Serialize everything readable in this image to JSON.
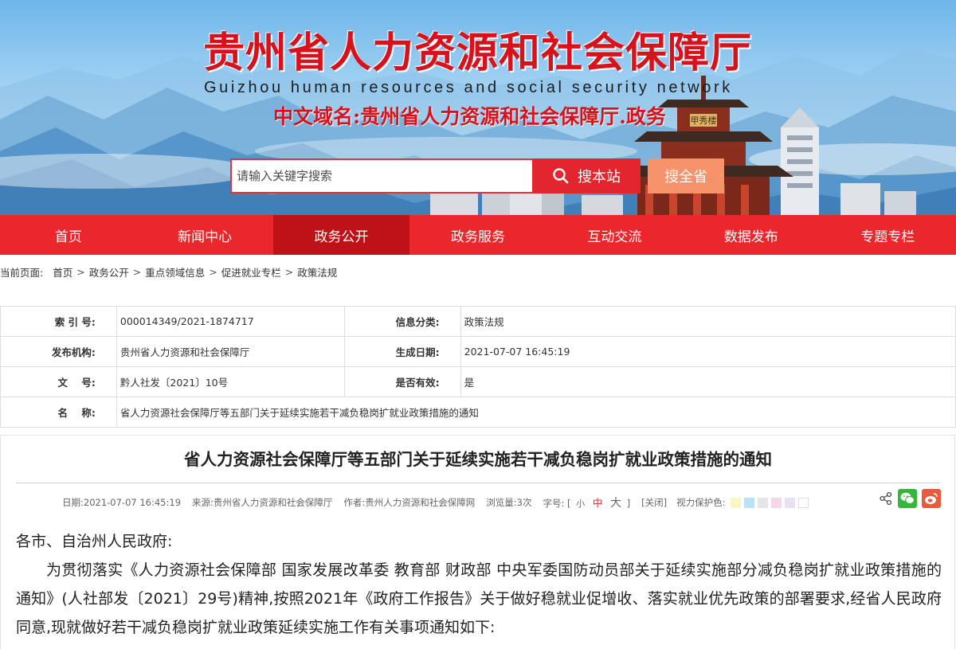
{
  "header": {
    "title": "贵州省人力资源和社会保障厅",
    "subtitle": "Guizhou human resources and social security network",
    "domain": "中文域名:贵州省人力资源和社会保障厅.政务",
    "gate_sign": "甲秀楼",
    "search": {
      "placeholder": "请输入关键字搜索",
      "site_button": "搜本站",
      "province_button": "搜全省"
    }
  },
  "nav": {
    "items": [
      {
        "label": "首页"
      },
      {
        "label": "新闻中心"
      },
      {
        "label": "政务公开"
      },
      {
        "label": "政务服务"
      },
      {
        "label": "互动交流"
      },
      {
        "label": "数据发布"
      },
      {
        "label": "专题专栏"
      }
    ],
    "active_index": 2
  },
  "breadcrumb": {
    "lead": "当前页面:",
    "items": [
      "首页",
      "政务公开",
      "重点领域信息",
      "促进就业专栏",
      "政策法规"
    ]
  },
  "info_table": {
    "index_label": "索 引 号:",
    "index_value": "000014349/2021-1874717",
    "category_label": "信息分类:",
    "category_value": "政策法规",
    "publisher_label": "发布机构:",
    "publisher_value": "贵州省人力资源和社会保障厅",
    "date_label": "生成日期:",
    "date_value": "2021-07-07 16:45:19",
    "docno_label": "文    号:",
    "docno_value": "黔人社发〔2021〕10号",
    "valid_label": "是否有效:",
    "valid_value": "是",
    "name_label": "名    称:",
    "name_value": "省人力资源社会保障厅等五部门关于延续实施若干减负稳岗扩就业政策措施的通知"
  },
  "article": {
    "title": "省人力资源社会保障厅等五部门关于延续实施若干减负稳岗扩就业政策措施的通知",
    "meta": {
      "date": "日期:2021-07-07 16:45:19",
      "source": "来源:贵州省人力资源和社会保障厅",
      "author": "作者:贵州人力资源和社会保障网",
      "views": "浏览量:3次",
      "fontsize_label": "字号:",
      "bracket_open": "[",
      "size_small": "小",
      "size_medium": "中",
      "size_large": "大",
      "bracket_close": "]",
      "close": "[关闭]",
      "vision_label": "视力保护色:"
    },
    "swatch_colors": [
      "#fbf7c5",
      "#b9e2f7",
      "#e6e6e6",
      "#f4d7e8",
      "#e9e0f4",
      "#ffffff"
    ],
    "greeting": "各市、自治州人民政府:",
    "paragraph": "为贯彻落实《人力资源社会保障部 国家发展改革委 教育部 财政部 中央军委国防动员部关于延续实施部分减负稳岗扩就业政策措施的通知》(人社部发〔2021〕29号)精神,按照2021年《政府工作报告》关于做好稳就业促增收、落实就业优先政策的部署要求,经省人民政府同意,现就做好若干减负稳岗扩就业政策延续实施工作有关事项通知如下:"
  },
  "colors": {
    "brand_red": "#e9272d",
    "active_red": "#bf1218",
    "province_orange": "#f7936a"
  }
}
